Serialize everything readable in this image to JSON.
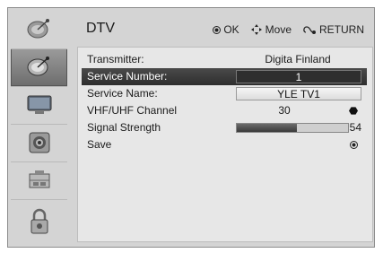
{
  "window": {
    "title": "DTV"
  },
  "hints": {
    "ok": "OK",
    "move": "Move",
    "return": "RETURN"
  },
  "sidebar": {
    "items": [
      {
        "name": "satellite-dish"
      },
      {
        "name": "tv-screen"
      },
      {
        "name": "speaker"
      },
      {
        "name": "clock-timer"
      },
      {
        "name": "lock"
      }
    ],
    "active_index": 0
  },
  "settings": {
    "transmitter": {
      "label": "Transmitter:",
      "value": "Digita Finland"
    },
    "service_number": {
      "label": "Service Number:",
      "value": "1"
    },
    "service_name": {
      "label": "Service Name:",
      "value": "YLE TV1"
    },
    "channel": {
      "label": "VHF/UHF Channel",
      "value": "30"
    },
    "signal": {
      "label": "Signal Strength",
      "value": "54",
      "level": 0.54
    },
    "save": {
      "label": "Save"
    }
  },
  "colors": {
    "selected_row": "#333333",
    "background": "#d4d4d4"
  }
}
